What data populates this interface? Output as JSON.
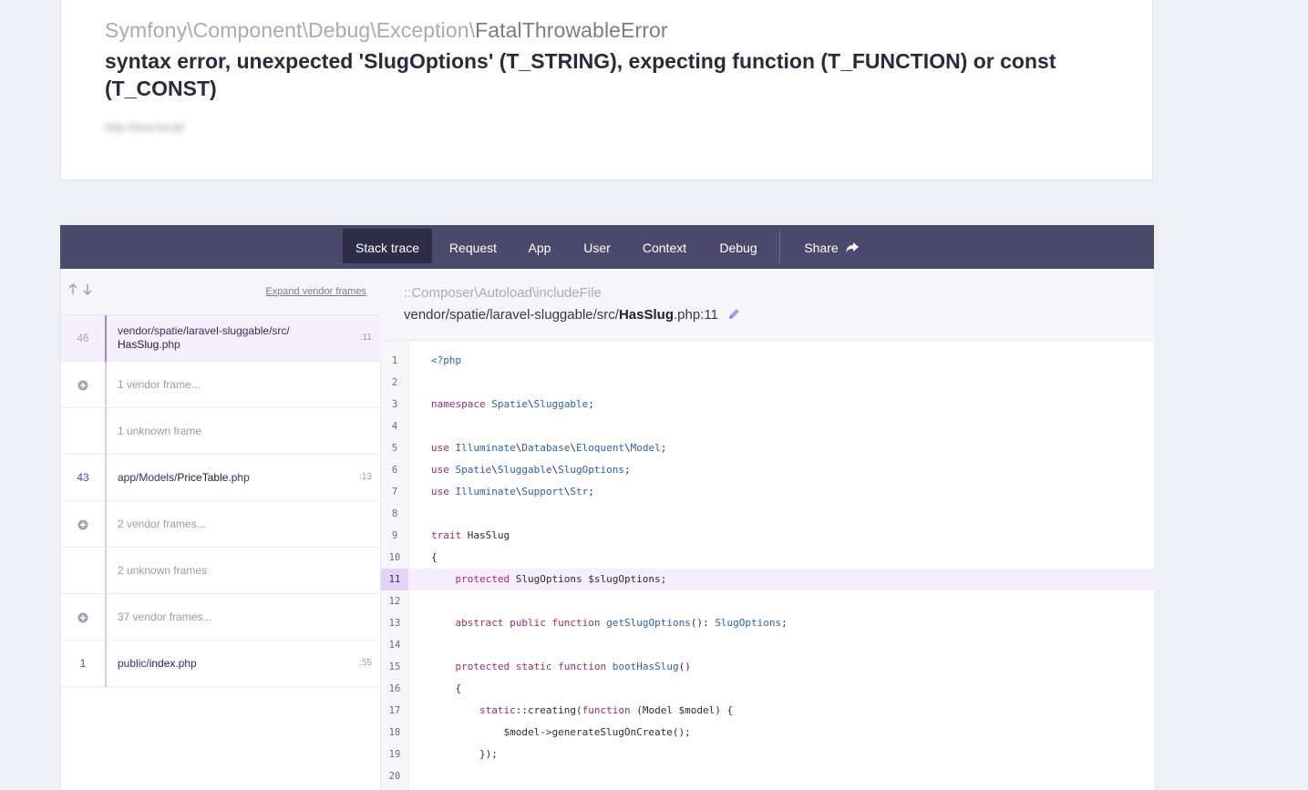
{
  "exception": {
    "namespace": "Symfony\\Component\\Debug\\Exception\\",
    "class_short": "FatalThrowableError",
    "message": "syntax error, unexpected 'SlugOptions' (T_STRING), expecting function (T_FUNCTION) or const (T_CONST)",
    "url": "http://test.local/"
  },
  "tabs": [
    {
      "label": "Stack trace",
      "active": true
    },
    {
      "label": "Request"
    },
    {
      "label": "App"
    },
    {
      "label": "User"
    },
    {
      "label": "Context"
    },
    {
      "label": "Debug"
    },
    {
      "label": "Share",
      "icon": "share-arrow-icon"
    }
  ],
  "sidebar": {
    "expand_vendor_label": "Expand vendor frames",
    "frames": [
      {
        "num": "46",
        "path": "vendor/spatie/laravel-sluggable/src/",
        "file": "HasSlug",
        "ext": ".php",
        "line": ":11",
        "kind": "selected"
      },
      {
        "label": "1 vendor frame...",
        "kind": "vendor"
      },
      {
        "label": "1 unknown frame",
        "kind": "unknown"
      },
      {
        "num": "43",
        "path": "app/Models/",
        "file": "PriceTable",
        "ext": ".php",
        "line": ":13",
        "kind": "app"
      },
      {
        "label": "2 vendor frames...",
        "kind": "vendor"
      },
      {
        "label": "2 unknown frames",
        "kind": "unknown"
      },
      {
        "label": "37 vendor frames...",
        "kind": "vendor"
      },
      {
        "num": "1",
        "path": "public/",
        "file": "index",
        "ext": ".php",
        "line": ":55",
        "kind": "app"
      }
    ]
  },
  "frame_detail": {
    "class": "::Composer\\Autoload\\includeFile",
    "path": "vendor/spatie/laravel-sluggable/src/",
    "file": "HasSlug",
    "ext": ".php",
    "line_suffix": ":11"
  },
  "code": {
    "highlight_line": 11,
    "lines": [
      {
        "n": "1",
        "html": "<span class=\"n\">&lt;?php</span>"
      },
      {
        "n": "2",
        "html": ""
      },
      {
        "n": "3",
        "html": "<span class=\"k\">namespace</span> <span class=\"n\">Spatie</span>\\<span class=\"n\">Sluggable</span>;"
      },
      {
        "n": "4",
        "html": ""
      },
      {
        "n": "5",
        "html": "<span class=\"k\">use</span> <span class=\"n\">Illuminate</span>\\<span class=\"n\">Database</span>\\<span class=\"n\">Eloquent</span>\\<span class=\"n\">Model</span>;"
      },
      {
        "n": "6",
        "html": "<span class=\"k\">use</span> <span class=\"n\">Spatie</span>\\<span class=\"n\">Sluggable</span>\\<span class=\"n\">SlugOptions</span>;"
      },
      {
        "n": "7",
        "html": "<span class=\"k\">use</span> <span class=\"n\">Illuminate</span>\\<span class=\"n\">Support</span>\\<span class=\"n\">Str</span>;"
      },
      {
        "n": "8",
        "html": ""
      },
      {
        "n": "9",
        "html": "<span class=\"k\">trait</span> HasSlug"
      },
      {
        "n": "10",
        "html": "{"
      },
      {
        "n": "11",
        "html": "    <span class=\"k\">protected</span> SlugOptions $slugOptions;"
      },
      {
        "n": "12",
        "html": ""
      },
      {
        "n": "13",
        "html": "    <span class=\"k\">abstract</span> <span class=\"k\">public</span> <span class=\"k\">function</span> <span class=\"n\">getSlugOptions</span>(): <span class=\"n\">SlugOptions</span>;"
      },
      {
        "n": "14",
        "html": ""
      },
      {
        "n": "15",
        "html": "    <span class=\"k\">protected</span> <span class=\"k\">static</span> <span class=\"k\">function</span> <span class=\"n\">bootHasSlug</span>()"
      },
      {
        "n": "16",
        "html": "    {"
      },
      {
        "n": "17",
        "html": "        <span class=\"k\">static</span>::creating(<span class=\"k\">function</span> (Model $model) {"
      },
      {
        "n": "18",
        "html": "            $model-&gt;generateSlugOnCreate();"
      },
      {
        "n": "19",
        "html": "        });"
      },
      {
        "n": "20",
        "html": ""
      }
    ]
  },
  "colors": {
    "tab_bar": "#4c4a6c",
    "tab_active": "#2e2c48",
    "highlight_line": "#f6eefc",
    "keyword": "#a2287c",
    "name": "#2b5fb8"
  }
}
